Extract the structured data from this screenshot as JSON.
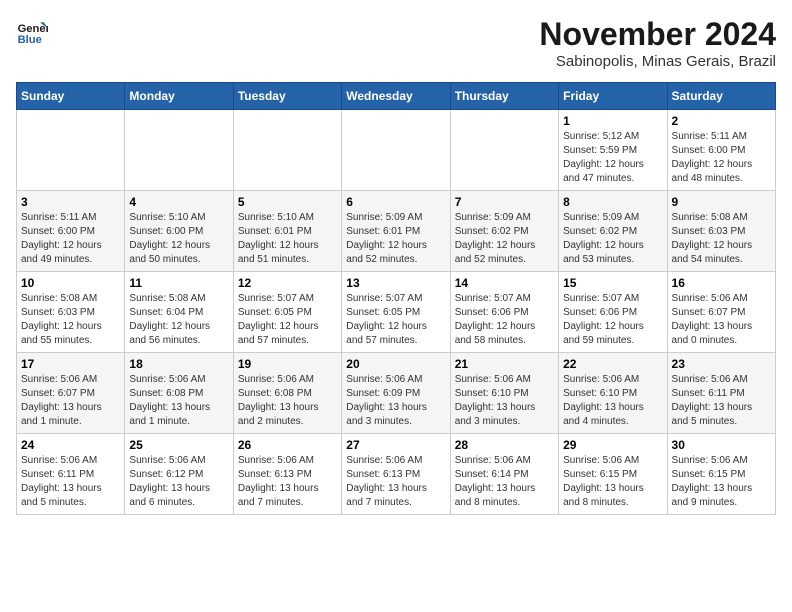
{
  "logo": {
    "line1": "General",
    "line2": "Blue"
  },
  "title": "November 2024",
  "subtitle": "Sabinopolis, Minas Gerais, Brazil",
  "weekdays": [
    "Sunday",
    "Monday",
    "Tuesday",
    "Wednesday",
    "Thursday",
    "Friday",
    "Saturday"
  ],
  "weeks": [
    [
      {
        "day": "",
        "info": ""
      },
      {
        "day": "",
        "info": ""
      },
      {
        "day": "",
        "info": ""
      },
      {
        "day": "",
        "info": ""
      },
      {
        "day": "",
        "info": ""
      },
      {
        "day": "1",
        "info": "Sunrise: 5:12 AM\nSunset: 5:59 PM\nDaylight: 12 hours\nand 47 minutes."
      },
      {
        "day": "2",
        "info": "Sunrise: 5:11 AM\nSunset: 6:00 PM\nDaylight: 12 hours\nand 48 minutes."
      }
    ],
    [
      {
        "day": "3",
        "info": "Sunrise: 5:11 AM\nSunset: 6:00 PM\nDaylight: 12 hours\nand 49 minutes."
      },
      {
        "day": "4",
        "info": "Sunrise: 5:10 AM\nSunset: 6:00 PM\nDaylight: 12 hours\nand 50 minutes."
      },
      {
        "day": "5",
        "info": "Sunrise: 5:10 AM\nSunset: 6:01 PM\nDaylight: 12 hours\nand 51 minutes."
      },
      {
        "day": "6",
        "info": "Sunrise: 5:09 AM\nSunset: 6:01 PM\nDaylight: 12 hours\nand 52 minutes."
      },
      {
        "day": "7",
        "info": "Sunrise: 5:09 AM\nSunset: 6:02 PM\nDaylight: 12 hours\nand 52 minutes."
      },
      {
        "day": "8",
        "info": "Sunrise: 5:09 AM\nSunset: 6:02 PM\nDaylight: 12 hours\nand 53 minutes."
      },
      {
        "day": "9",
        "info": "Sunrise: 5:08 AM\nSunset: 6:03 PM\nDaylight: 12 hours\nand 54 minutes."
      }
    ],
    [
      {
        "day": "10",
        "info": "Sunrise: 5:08 AM\nSunset: 6:03 PM\nDaylight: 12 hours\nand 55 minutes."
      },
      {
        "day": "11",
        "info": "Sunrise: 5:08 AM\nSunset: 6:04 PM\nDaylight: 12 hours\nand 56 minutes."
      },
      {
        "day": "12",
        "info": "Sunrise: 5:07 AM\nSunset: 6:05 PM\nDaylight: 12 hours\nand 57 minutes."
      },
      {
        "day": "13",
        "info": "Sunrise: 5:07 AM\nSunset: 6:05 PM\nDaylight: 12 hours\nand 57 minutes."
      },
      {
        "day": "14",
        "info": "Sunrise: 5:07 AM\nSunset: 6:06 PM\nDaylight: 12 hours\nand 58 minutes."
      },
      {
        "day": "15",
        "info": "Sunrise: 5:07 AM\nSunset: 6:06 PM\nDaylight: 12 hours\nand 59 minutes."
      },
      {
        "day": "16",
        "info": "Sunrise: 5:06 AM\nSunset: 6:07 PM\nDaylight: 13 hours\nand 0 minutes."
      }
    ],
    [
      {
        "day": "17",
        "info": "Sunrise: 5:06 AM\nSunset: 6:07 PM\nDaylight: 13 hours\nand 1 minute."
      },
      {
        "day": "18",
        "info": "Sunrise: 5:06 AM\nSunset: 6:08 PM\nDaylight: 13 hours\nand 1 minute."
      },
      {
        "day": "19",
        "info": "Sunrise: 5:06 AM\nSunset: 6:08 PM\nDaylight: 13 hours\nand 2 minutes."
      },
      {
        "day": "20",
        "info": "Sunrise: 5:06 AM\nSunset: 6:09 PM\nDaylight: 13 hours\nand 3 minutes."
      },
      {
        "day": "21",
        "info": "Sunrise: 5:06 AM\nSunset: 6:10 PM\nDaylight: 13 hours\nand 3 minutes."
      },
      {
        "day": "22",
        "info": "Sunrise: 5:06 AM\nSunset: 6:10 PM\nDaylight: 13 hours\nand 4 minutes."
      },
      {
        "day": "23",
        "info": "Sunrise: 5:06 AM\nSunset: 6:11 PM\nDaylight: 13 hours\nand 5 minutes."
      }
    ],
    [
      {
        "day": "24",
        "info": "Sunrise: 5:06 AM\nSunset: 6:11 PM\nDaylight: 13 hours\nand 5 minutes."
      },
      {
        "day": "25",
        "info": "Sunrise: 5:06 AM\nSunset: 6:12 PM\nDaylight: 13 hours\nand 6 minutes."
      },
      {
        "day": "26",
        "info": "Sunrise: 5:06 AM\nSunset: 6:13 PM\nDaylight: 13 hours\nand 7 minutes."
      },
      {
        "day": "27",
        "info": "Sunrise: 5:06 AM\nSunset: 6:13 PM\nDaylight: 13 hours\nand 7 minutes."
      },
      {
        "day": "28",
        "info": "Sunrise: 5:06 AM\nSunset: 6:14 PM\nDaylight: 13 hours\nand 8 minutes."
      },
      {
        "day": "29",
        "info": "Sunrise: 5:06 AM\nSunset: 6:15 PM\nDaylight: 13 hours\nand 8 minutes."
      },
      {
        "day": "30",
        "info": "Sunrise: 5:06 AM\nSunset: 6:15 PM\nDaylight: 13 hours\nand 9 minutes."
      }
    ]
  ]
}
